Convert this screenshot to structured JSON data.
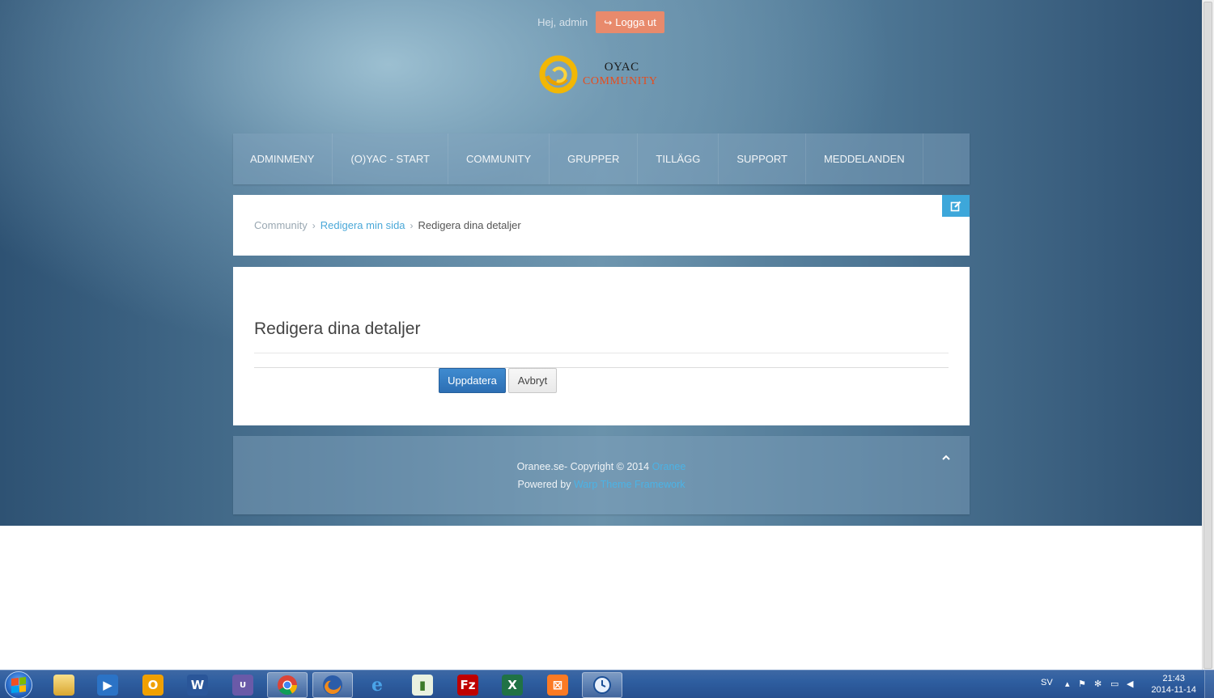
{
  "header": {
    "greeting": "Hej, admin",
    "logout_label": "Logga ut",
    "logo_line1": "OYAC",
    "logo_line2": "COMMUNITY"
  },
  "nav": {
    "items": [
      {
        "label": "ADMINMENY"
      },
      {
        "label": "(O)YAC - START"
      },
      {
        "label": "COMMUNITY"
      },
      {
        "label": "GRUPPER"
      },
      {
        "label": "TILLÄGG"
      },
      {
        "label": "SUPPORT"
      },
      {
        "label": "MEDDELANDEN"
      }
    ]
  },
  "breadcrumb": {
    "items": [
      "Community",
      "Redigera min sida",
      "Redigera dina detaljer"
    ],
    "separator": "›"
  },
  "main": {
    "title": "Redigera dina detaljer",
    "update_label": "Uppdatera",
    "cancel_label": "Avbryt"
  },
  "footer": {
    "copyright": "Oranee.se- Copyright © 2014 ",
    "copyright_link": "Oranee",
    "powered": "Powered by ",
    "powered_link": "Warp Theme Framework"
  },
  "taskbar": {
    "apps": [
      {
        "name": "file-explorer",
        "icon": "folder-icon"
      },
      {
        "name": "media-player",
        "icon": "media-player-icon"
      },
      {
        "name": "outlook",
        "icon": "outlook-icon"
      },
      {
        "name": "word",
        "icon": "word-icon"
      },
      {
        "name": "unibas",
        "icon": "unibas-icon"
      },
      {
        "name": "chrome",
        "icon": "chrome-icon"
      },
      {
        "name": "firefox",
        "icon": "firefox-icon"
      },
      {
        "name": "internet-explorer",
        "icon": "ie-icon"
      },
      {
        "name": "project",
        "icon": "project-icon"
      },
      {
        "name": "filezilla",
        "icon": "filezilla-icon"
      },
      {
        "name": "excel",
        "icon": "excel-icon"
      },
      {
        "name": "xampp",
        "icon": "xampp-icon"
      },
      {
        "name": "time-machine",
        "icon": "clock-icon"
      }
    ],
    "language": "SV",
    "time": "21:43",
    "date": "2014-11-14"
  },
  "colors": {
    "accent": "#3da7da",
    "logout": "#e88a6c",
    "primary_button": "#2d6fb4",
    "link": "#4aa8d8"
  }
}
